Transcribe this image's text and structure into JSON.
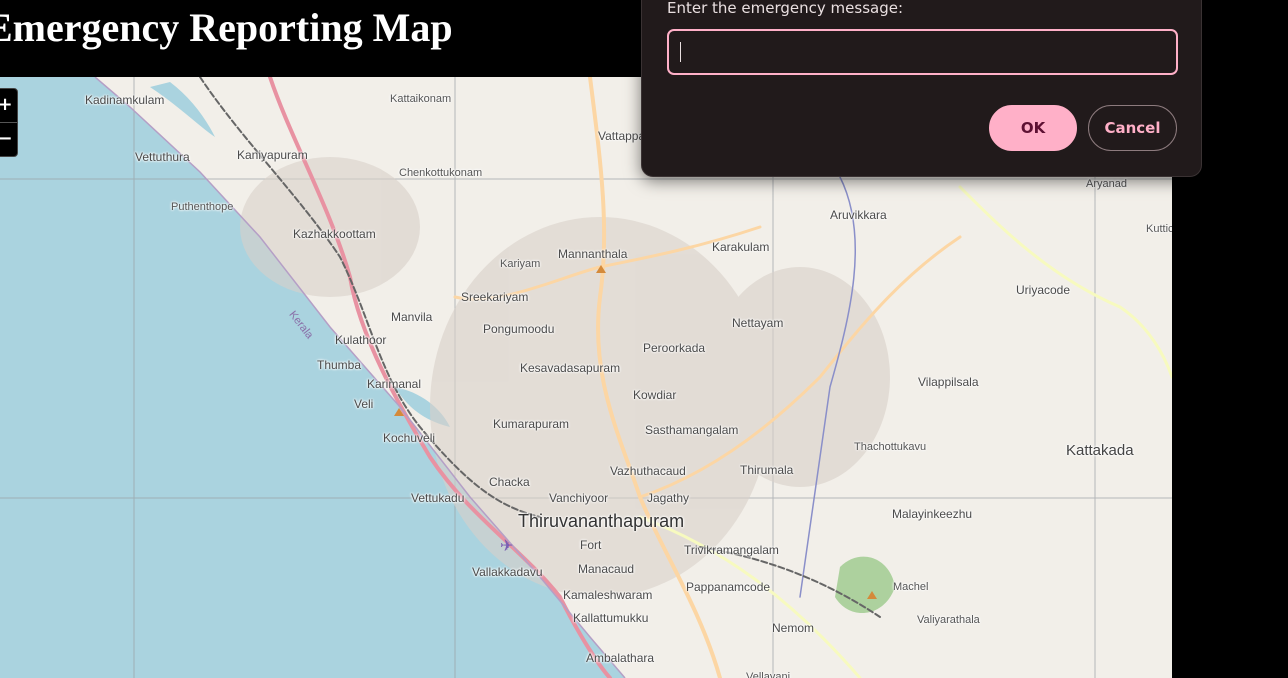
{
  "page": {
    "title": "Emergency Reporting Map"
  },
  "map": {
    "zoom_in_label": "+",
    "zoom_out_label": "−",
    "places": [
      {
        "name": "Kadinamkulam",
        "size": "normal"
      },
      {
        "name": "Kattaikonam",
        "size": "small"
      },
      {
        "name": "Vattappara",
        "size": "normal"
      },
      {
        "name": "Vettuthura",
        "size": "normal"
      },
      {
        "name": "Kaniyapuram",
        "size": "normal"
      },
      {
        "name": "Chenkottukonam",
        "size": "small"
      },
      {
        "name": "Aryanad",
        "size": "small"
      },
      {
        "name": "Puthenthope",
        "size": "small"
      },
      {
        "name": "Aruvikkara",
        "size": "normal"
      },
      {
        "name": "Kazhakkoottam",
        "size": "normal"
      },
      {
        "name": "Karakulam",
        "size": "normal"
      },
      {
        "name": "Kuttichal",
        "size": "small"
      },
      {
        "name": "Mannanthala",
        "size": "normal"
      },
      {
        "name": "Kariyam",
        "size": "small"
      },
      {
        "name": "Uriyacode",
        "size": "normal"
      },
      {
        "name": "Sreekariyam",
        "size": "normal"
      },
      {
        "name": "Manvila",
        "size": "normal"
      },
      {
        "name": "Nettayam",
        "size": "normal"
      },
      {
        "name": "Pongumoodu",
        "size": "normal"
      },
      {
        "name": "Kulathoor",
        "size": "normal"
      },
      {
        "name": "Peroorkada",
        "size": "normal"
      },
      {
        "name": "Thumba",
        "size": "normal"
      },
      {
        "name": "Kesavadasapuram",
        "size": "normal"
      },
      {
        "name": "Karimanal",
        "size": "normal"
      },
      {
        "name": "Vilappilsala",
        "size": "normal"
      },
      {
        "name": "Kowdiar",
        "size": "normal"
      },
      {
        "name": "Veli",
        "size": "normal"
      },
      {
        "name": "Kumarapuram",
        "size": "normal"
      },
      {
        "name": "Sasthamangalam",
        "size": "normal"
      },
      {
        "name": "Kochuveli",
        "size": "normal"
      },
      {
        "name": "Thachottukavu",
        "size": "small"
      },
      {
        "name": "Kattakada",
        "size": "medium"
      },
      {
        "name": "Vazhuthacaud",
        "size": "normal"
      },
      {
        "name": "Thirumala",
        "size": "normal"
      },
      {
        "name": "Chacka",
        "size": "normal"
      },
      {
        "name": "Vettukadu",
        "size": "normal"
      },
      {
        "name": "Vanchiyoor",
        "size": "normal"
      },
      {
        "name": "Jagathy",
        "size": "normal"
      },
      {
        "name": "Malayinkeezhu",
        "size": "normal"
      },
      {
        "name": "Thiruvananthapuram",
        "size": "large"
      },
      {
        "name": "Fort",
        "size": "normal"
      },
      {
        "name": "Trivikramangalam",
        "size": "normal"
      },
      {
        "name": "Vallakkadavu",
        "size": "normal"
      },
      {
        "name": "Manacaud",
        "size": "normal"
      },
      {
        "name": "Machel",
        "size": "small"
      },
      {
        "name": "Pappanamcode",
        "size": "normal"
      },
      {
        "name": "Kamaleshwaram",
        "size": "normal"
      },
      {
        "name": "Valiyarathala",
        "size": "small"
      },
      {
        "name": "Kallattumukku",
        "size": "normal"
      },
      {
        "name": "Nemom",
        "size": "normal"
      },
      {
        "name": "Ambalathara",
        "size": "normal"
      },
      {
        "name": "Vellayani",
        "size": "small"
      },
      {
        "name": "Kerala",
        "size": "coast"
      }
    ]
  },
  "dialog": {
    "message": "Enter the emergency message:",
    "input_value": "",
    "ok_label": "OK",
    "cancel_label": "Cancel"
  },
  "colors": {
    "sea": "#aad3df",
    "land": "#f2efe9",
    "dialog_background": "#211a1b",
    "accent_pink": "#ffb0c8"
  }
}
